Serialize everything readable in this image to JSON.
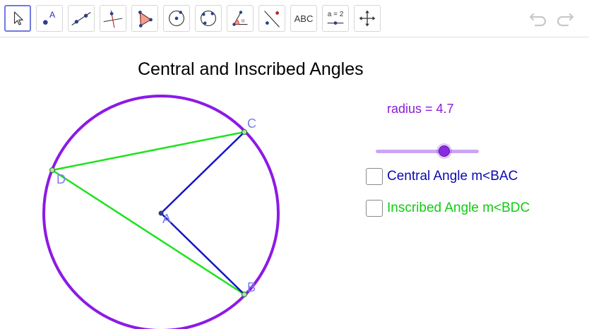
{
  "toolbar": {
    "tools": [
      {
        "name": "move-tool",
        "icon": "cursor-arrow-icon",
        "active": true
      },
      {
        "name": "point-tool",
        "icon": "point-icon"
      },
      {
        "name": "line-tool",
        "icon": "line-through-points-icon"
      },
      {
        "name": "perpendicular-tool",
        "icon": "perpendicular-line-icon"
      },
      {
        "name": "polygon-tool",
        "icon": "polygon-icon"
      },
      {
        "name": "circle-center-point-tool",
        "icon": "circle-center-point-icon"
      },
      {
        "name": "circle-three-points-tool",
        "icon": "circle-three-points-icon"
      },
      {
        "name": "angle-tool",
        "icon": "angle-icon"
      },
      {
        "name": "reflect-tool",
        "icon": "reflect-about-line-icon"
      },
      {
        "name": "text-tool",
        "icon": "text-icon",
        "label": "ABC"
      },
      {
        "name": "slider-tool",
        "icon": "slider-icon",
        "label": "a = 2"
      },
      {
        "name": "move-graphics-view-tool",
        "icon": "move-arrows-icon"
      }
    ],
    "undo_icon": "undo-icon",
    "redo_icon": "redo-icon"
  },
  "title": "Central and Inscribed Angles",
  "radius": {
    "label": "radius = 4.7",
    "value": 4.7,
    "color": "#8a1cd8"
  },
  "checkboxes": [
    {
      "label": "Central Angle m<BAC",
      "checked": false,
      "color": "#0a0ab0"
    },
    {
      "label": "Inscribed Angle m<BDC",
      "checked": false,
      "color": "#11cc11"
    }
  ],
  "points": {
    "A": "A",
    "B": "B",
    "C": "C",
    "D": "D"
  },
  "colors": {
    "circle": "#8c1ae6",
    "central_segments": "#1414c8",
    "inscribed_segments": "#1fe21f",
    "point_labels": "#7b7bef"
  }
}
